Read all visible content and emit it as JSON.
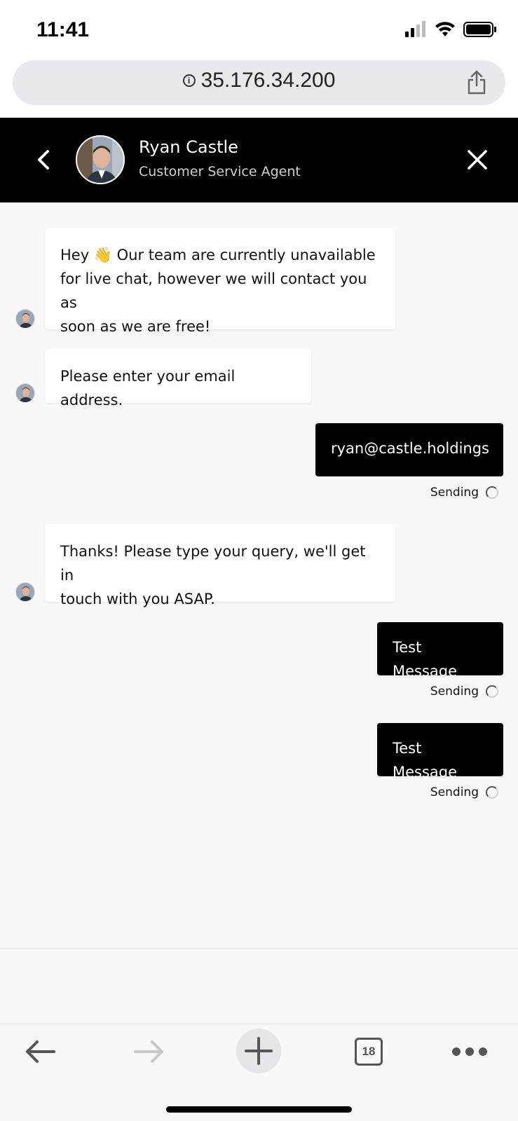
{
  "status_bar": {
    "time": "11:41"
  },
  "browser": {
    "url": "35.176.34.200",
    "tabs_count": "18"
  },
  "chat_header": {
    "agent_name": "Ryan Castle",
    "agent_role": "Customer Service Agent"
  },
  "messages": [
    {
      "from": "agent",
      "text_lines": [
        "Hey 👋 Our team are currently unavailable",
        "for live chat, however we will contact you as",
        "soon as we are free!"
      ]
    },
    {
      "from": "agent",
      "text": "Please enter your email address."
    },
    {
      "from": "user",
      "text": "ryan@castle.holdings",
      "status": "Sending"
    },
    {
      "from": "agent",
      "text_lines": [
        "Thanks! Please type your query, we'll get in",
        "touch with you ASAP."
      ]
    },
    {
      "from": "user",
      "text": "Test Message",
      "status": "Sending"
    },
    {
      "from": "user",
      "text": "Test Message",
      "status": "Sending"
    }
  ],
  "colors": {
    "header_bg": "#000000",
    "user_bubble": "#000000",
    "agent_bubble": "#ffffff",
    "chat_bg": "#f8f8f8"
  }
}
